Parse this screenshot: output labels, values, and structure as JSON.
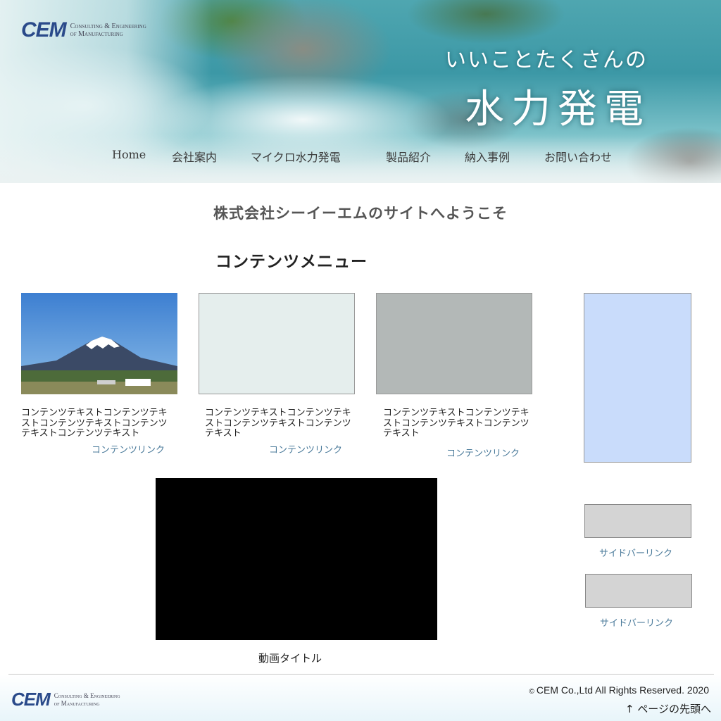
{
  "header": {
    "logo_mark": "CEM",
    "logo_sub_line1": "Consulting & Engineering",
    "logo_sub_line2": "of Manufacturing",
    "hero_line1": "いいことたくさんの",
    "hero_line2": "水力発電"
  },
  "nav": {
    "items": [
      "Home",
      "会社案内",
      "マイクロ水力発電",
      "製品紹介",
      "納入事例",
      "お問い合わせ"
    ]
  },
  "main": {
    "welcome": "株式会社シーイーエムのサイトへようこそ",
    "menu_heading": "コンテンツメニュー",
    "cards": [
      {
        "text": "コンテンツテキストコンテンツテキストコンテンツテキストコンテンツテキストコンテンツテキスト",
        "link": "コンテンツリンク",
        "image": "mount-fuji-photo"
      },
      {
        "text": "コンテンツテキストコンテンツテキストコンテンツテキストコンテンツテキスト",
        "link": "コンテンツリンク",
        "image": "placeholder-light"
      },
      {
        "text": "コンテンツテキストコンテンツテキストコンテンツテキストコンテンツテキスト",
        "link": "コンテンツリンク",
        "image": "placeholder-gray"
      }
    ],
    "video_title": "動画タイトル"
  },
  "sidebar": {
    "links": [
      "サイドバーリンク",
      "サイドバーリンク"
    ]
  },
  "footer": {
    "logo_mark": "CEM",
    "logo_sub_line1": "Consulting & Engineering",
    "logo_sub_line2": "of Manufacturing",
    "copyright_symbol": "©",
    "copyright": "CEM Co.,Ltd All Rights Reserved. 2020",
    "to_top": "↑ ページの先頭へ"
  },
  "colors": {
    "link": "#4a7a9a",
    "logo": "#2a4a8a",
    "sidebar_banner": "#c9dcfb"
  }
}
